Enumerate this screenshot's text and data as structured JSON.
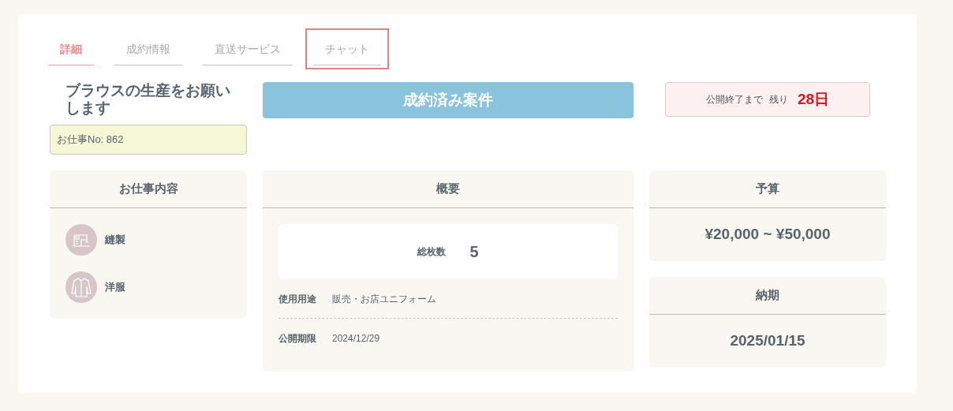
{
  "tabs": [
    {
      "label": "詳細",
      "selected": true,
      "focused": false
    },
    {
      "label": "成約情報",
      "selected": false,
      "focused": false
    },
    {
      "label": "直送サービス",
      "selected": false,
      "focused": false
    },
    {
      "label": "チャット",
      "selected": false,
      "focused": true
    }
  ],
  "job": {
    "title": "ブラウスの生産をお願いします",
    "number": "お仕事No: 862"
  },
  "status_banner": "成約済み案件",
  "deadline": {
    "label": "公開終了まで",
    "remaining_label": "残り",
    "remaining": "28日"
  },
  "work_content": {
    "title": "お仕事内容",
    "items": [
      {
        "kind": "sewing",
        "label": "縫製"
      },
      {
        "kind": "clothing",
        "label": "洋服"
      }
    ]
  },
  "overview": {
    "title": "概要",
    "total_label": "総枚数",
    "total": "5",
    "rows": [
      {
        "label": "使用用途",
        "value": "販売・お店ユニフォーム"
      },
      {
        "label": "公開期限",
        "value": "2024/12/29"
      }
    ]
  },
  "budget": {
    "title": "予算",
    "value": "¥20,000 ~ ¥50,000"
  },
  "delivery": {
    "title": "納期",
    "value": "2025/01/15"
  }
}
